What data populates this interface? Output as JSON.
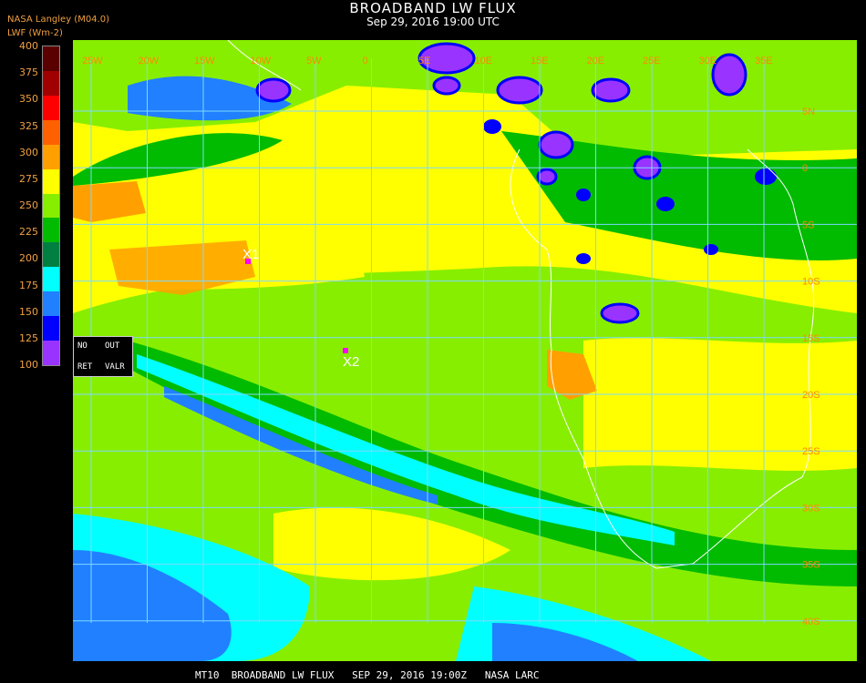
{
  "header": {
    "title": "BROADBAND LW FLUX",
    "datetime": "Sep 29, 2016 19:00 UTC",
    "org": "NASA Langley (M04.0)",
    "units": "LWF (Wm-2)"
  },
  "legend": {
    "ticks": [
      "400",
      "375",
      "350",
      "325",
      "300",
      "275",
      "250",
      "225",
      "200",
      "175",
      "150",
      "125",
      "100"
    ],
    "colors": [
      "#5a0000",
      "#a00000",
      "#ff0000",
      "#ff6000",
      "#ffa000",
      "#ffff00",
      "#88ee00",
      "#00bb00",
      "#008040",
      "#00ffff",
      "#2080ff",
      "#0000ff",
      "#9933ff"
    ]
  },
  "map": {
    "lon_labels": [
      "25W",
      "20W",
      "15W",
      "10W",
      "5W",
      "0",
      "5E",
      "10E",
      "15E",
      "20E",
      "25E",
      "30E",
      "35E"
    ],
    "lat_labels": [
      "5N",
      "0",
      "5S",
      "10S",
      "15S",
      "20S",
      "25S",
      "30S",
      "35S",
      "40S"
    ],
    "markers": [
      {
        "label": "X1",
        "color": "#ff00ff"
      },
      {
        "label": "X2",
        "color": "#ff00ff"
      }
    ],
    "control_box": {
      "no": "NO",
      "out": "OUT",
      "ret": "RET",
      "valr": "VALR"
    }
  },
  "footer": "MT10  BROADBAND LW FLUX   SEP 29, 2016 19:00Z   NASA LARC"
}
